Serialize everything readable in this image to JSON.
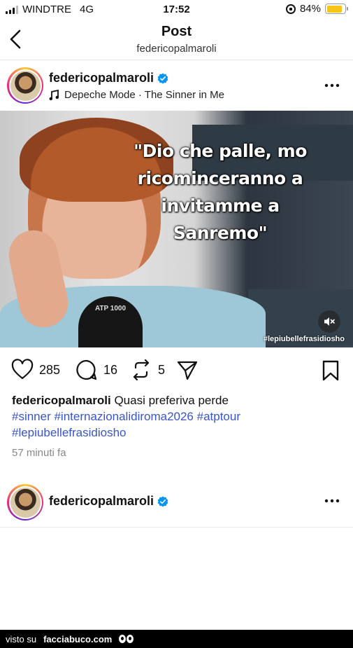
{
  "status_bar": {
    "carrier": "WINDTRE",
    "network": "4G",
    "time": "17:52",
    "battery": "84%",
    "battery_level": 0.84,
    "battery_color": "#f5c518"
  },
  "header": {
    "title": "Post",
    "subtitle": "federicopalmaroli",
    "back_icon": "chevron-left-icon"
  },
  "post": {
    "username": "federicopalmaroli",
    "verified": true,
    "music": "Depeche Mode · The Sinner in Me",
    "image": {
      "overlay_lines": [
        "\"Dio che palle, mo",
        "ricominceranno a",
        "invitamme a",
        "Sanremo\""
      ],
      "watermark": "#lepiubellefrasidiosho",
      "mic_text": "ATP 1000"
    },
    "actions": {
      "likes": "285",
      "comments": "16",
      "reposts": "5"
    },
    "caption": {
      "username": "federicopalmaroli",
      "text": "Quasi preferiva perde",
      "hashtags": "#sinner #internazionalidiroma2026 #atptour #lepiubellefrasidiosho"
    },
    "time_ago": "57 minuti fa"
  },
  "next_post": {
    "username": "federicopalmaroli"
  },
  "footer": {
    "prefix": "visto su",
    "site": "facciabuco.com"
  },
  "colors": {
    "hashtag": "#3a55c8",
    "verified": "#0095f6"
  }
}
